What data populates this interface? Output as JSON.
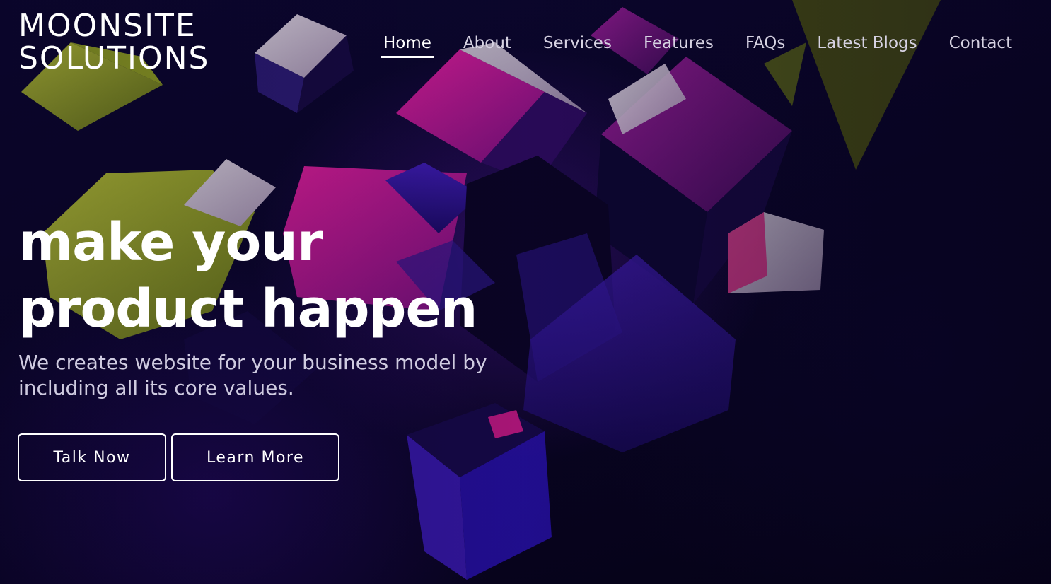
{
  "brand": {
    "line1": "MOONSITE",
    "line2": "SOLUTIONS"
  },
  "nav": {
    "items": [
      {
        "label": "Home",
        "active": true
      },
      {
        "label": "About",
        "active": false
      },
      {
        "label": "Services",
        "active": false
      },
      {
        "label": "Features",
        "active": false
      },
      {
        "label": "FAQs",
        "active": false
      },
      {
        "label": "Latest Blogs",
        "active": false
      },
      {
        "label": "Contact",
        "active": false
      }
    ]
  },
  "hero": {
    "headline_line1": "make your",
    "headline_line2": "product happen",
    "subtitle": "We creates website for your business model by including all its core values.",
    "primary_button": "Talk Now",
    "secondary_button": "Learn More"
  },
  "colors": {
    "background": "#06031a",
    "magenta": "#c2187e",
    "lime": "#9aa32a",
    "violet": "#2a1580",
    "text": "#ffffff",
    "nav_text": "#d6d2e2"
  }
}
